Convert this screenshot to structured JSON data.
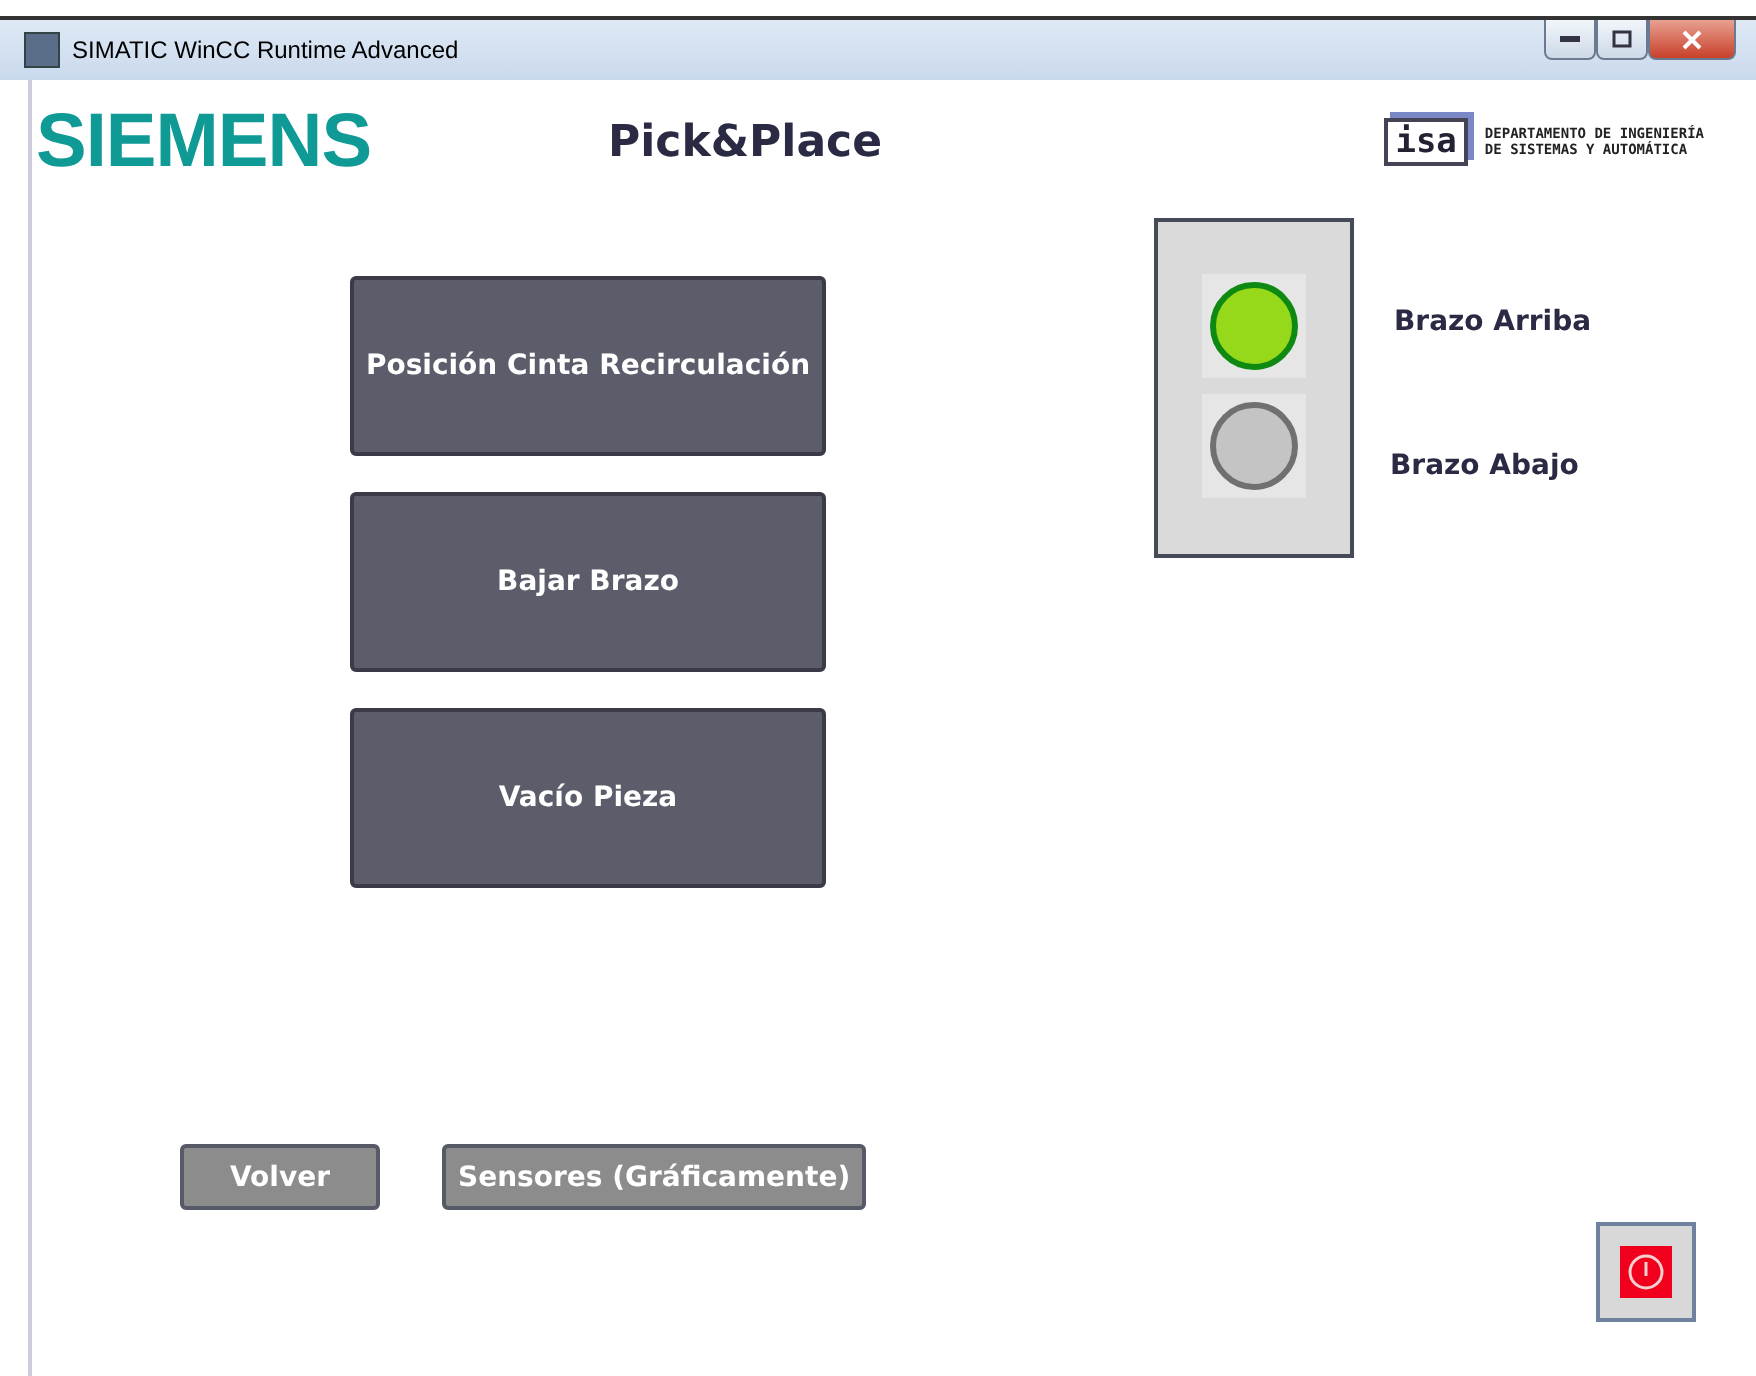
{
  "window": {
    "title": "SIMATIC WinCC Runtime Advanced"
  },
  "header": {
    "brand": "SIEMENS",
    "title": "Pick&Place",
    "logo": {
      "mark": "isa",
      "line_1": "DEPARTAMENTO DE INGENIERÍA",
      "line_2": "DE SISTEMAS Y AUTOMÁTICA"
    }
  },
  "actions": [
    {
      "label": "Posición Cinta Recirculación"
    },
    {
      "label": "Bajar Brazo"
    },
    {
      "label": "Vacío Pieza"
    }
  ],
  "indicators": [
    {
      "label": "Brazo Arriba",
      "on": true
    },
    {
      "label": "Brazo Abajo",
      "on": false
    }
  ],
  "navigation": [
    {
      "label": "Volver",
      "disabled": true
    },
    {
      "label": "Sensores (Gráficamente)",
      "disabled": true
    }
  ]
}
